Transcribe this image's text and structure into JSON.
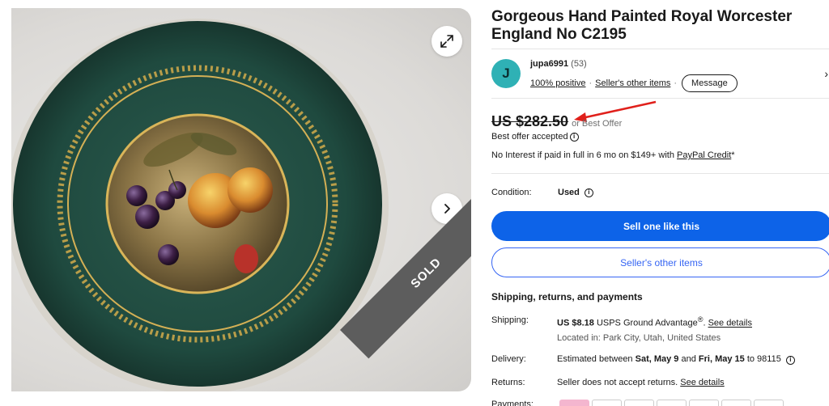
{
  "listing": {
    "title": "Gorgeous Hand Painted Royal Worcester England No C2195",
    "sold_label": "SOLD"
  },
  "seller": {
    "avatar_letter": "J",
    "name": "jupa6991",
    "feedback_count": "(53)",
    "positive": "100% positive",
    "other_items_link": "Seller's other items",
    "message_button": "Message"
  },
  "price": {
    "amount": "US $282.50",
    "best_offer": "or Best Offer",
    "offer_status": "Best offer accepted",
    "interest_text": "No Interest if paid in full in 6 mo on $149+ with ",
    "paypal_credit": "PayPal Credit",
    "asterisk": "*"
  },
  "condition": {
    "label": "Condition:",
    "value": "Used"
  },
  "actions": {
    "sell_one": "Sell one like this",
    "sellers_other_items": "Seller's other items"
  },
  "shipping": {
    "heading": "Shipping, returns, and payments",
    "shipping_label": "Shipping:",
    "shipping_cost": "US $8.18",
    "shipping_service": "USPS Ground Advantage",
    "registered": "®",
    "see_details": "See details",
    "location": "Located in: Park City, Utah, United States",
    "delivery_label": "Delivery:",
    "delivery_prefix": "Estimated between ",
    "delivery_start": "Sat, May 9",
    "delivery_and": " and ",
    "delivery_end": "Fri, May 15",
    "delivery_to": " to 98115",
    "returns_label": "Returns:",
    "returns_text": "Seller does not accept returns. ",
    "returns_link": "See details",
    "payments_label": "Payments:"
  },
  "icons": {
    "expand": "expand-icon",
    "next": "chevron-right-icon",
    "info": "info-icon"
  },
  "colors": {
    "primary_blue": "#0d63e8",
    "link_blue": "#3665f3",
    "avatar_teal": "#2fb1b5",
    "sold_ribbon": "#5d5d5d",
    "arrow_red": "#e0201b"
  }
}
